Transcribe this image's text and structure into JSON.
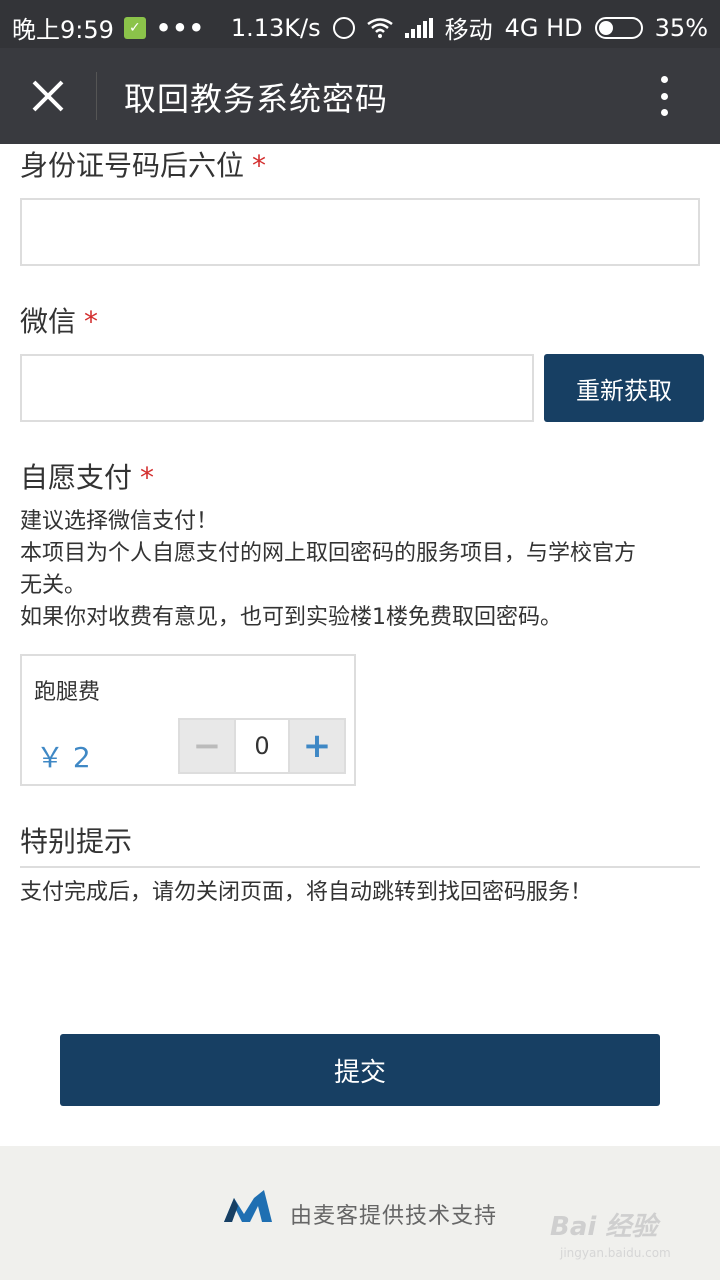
{
  "status_bar": {
    "time": "晚上9:59",
    "more": "•••",
    "speed": "1.13K/s",
    "carrier": "移动",
    "network": "4G HD",
    "battery": "35%"
  },
  "navbar": {
    "title": "取回教务系统密码"
  },
  "form": {
    "id_label": "身份证号码后六位",
    "id_value": "",
    "wechat_label": "微信",
    "wechat_value": "",
    "refresh_button": "重新获取",
    "pay_label": "自愿支付",
    "required_mark": "*",
    "pay_desc": [
      "建议选择微信支付！",
      "本项目为个人自愿支付的网上取回密码的服务项目，与学校官方",
      "无关。",
      "如果你对收费有意见，也可到实验楼1楼免费取回密码。"
    ],
    "fee": {
      "name": "跑腿费",
      "price": "￥ 2",
      "quantity": "0",
      "minus": "−",
      "plus": "+"
    },
    "special_title": "特别提示",
    "special_text": "支付完成后，请勿关闭页面，将自动跳转到找回密码服务！",
    "submit_button": "提交"
  },
  "footer": {
    "text": "由麦客提供技术支持",
    "watermark": "Bai 经验",
    "watermark_sub": "jingyan.baidu.com"
  },
  "colors": {
    "accent": "#173f63",
    "required": "#d32f2f",
    "price": "#3f88c5"
  }
}
